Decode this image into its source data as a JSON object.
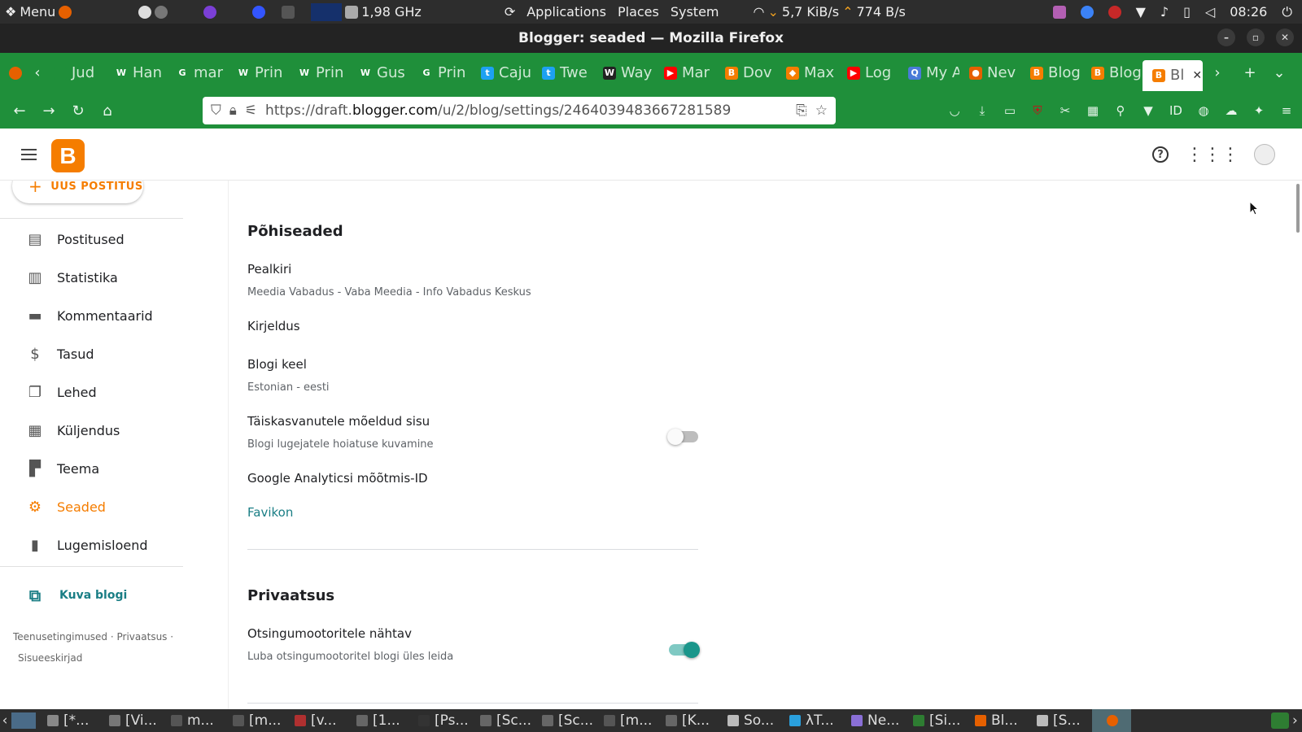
{
  "system_panel": {
    "menu_label": "Menu",
    "cpu_freq": "1,98 GHz",
    "menus": [
      "Applications",
      "Places",
      "System"
    ],
    "net_down": "5,7 KiB/s",
    "net_up": "774 B/s",
    "clock": "08:26"
  },
  "window": {
    "title": "Blogger: seaded — Mozilla Firefox"
  },
  "tabs": [
    {
      "label": "Jud",
      "fav": "",
      "color": "#1f8f3a"
    },
    {
      "label": "Han",
      "fav": "W",
      "color": "#ffffff"
    },
    {
      "label": "mar",
      "fav": "G",
      "color": "#ffffff"
    },
    {
      "label": "Prin",
      "fav": "W",
      "color": "#ffffff"
    },
    {
      "label": "Prin",
      "fav": "W",
      "color": "#ffffff"
    },
    {
      "label": "Gus",
      "fav": "W",
      "color": "#ffffff"
    },
    {
      "label": "Prin",
      "fav": "G",
      "color": "#ffffff"
    },
    {
      "label": "Caju",
      "fav": "t",
      "color": "#1da1f2"
    },
    {
      "label": "Twe",
      "fav": "t",
      "color": "#1da1f2"
    },
    {
      "label": "Way",
      "fav": "W",
      "color": "#222222"
    },
    {
      "label": "Mar",
      "fav": "▶",
      "color": "#ff0000"
    },
    {
      "label": "Dov",
      "fav": "B",
      "color": "#f57d00"
    },
    {
      "label": "Max",
      "fav": "◆",
      "color": "#f57d00"
    },
    {
      "label": "Log",
      "fav": "▶",
      "color": "#ff0000"
    },
    {
      "label": "My A",
      "fav": "Q",
      "color": "#4a7bd8"
    },
    {
      "label": "Nev",
      "fav": "●",
      "color": "#e66000"
    },
    {
      "label": "Blog",
      "fav": "B",
      "color": "#f57d00"
    },
    {
      "label": "Blog",
      "fav": "B",
      "color": "#f57d00"
    }
  ],
  "active_tab": {
    "label": "Bl",
    "fav": "B"
  },
  "url": {
    "prefix": "https://draft.",
    "domain": "blogger.com",
    "path": "/u/2/blog/settings/2464039483667281589"
  },
  "sidebar": {
    "new_post": "UUS POSTITUS",
    "items": [
      {
        "label": "Postitused",
        "icon": "posts-icon",
        "glyph": "▤"
      },
      {
        "label": "Statistika",
        "icon": "stats-icon",
        "glyph": "▥"
      },
      {
        "label": "Kommentaarid",
        "icon": "comments-icon",
        "glyph": "▬"
      },
      {
        "label": "Tasud",
        "icon": "dollar-icon",
        "glyph": "$"
      },
      {
        "label": "Lehed",
        "icon": "pages-icon",
        "glyph": "❐"
      },
      {
        "label": "Küljendus",
        "icon": "layout-icon",
        "glyph": "▦"
      },
      {
        "label": "Teema",
        "icon": "theme-icon",
        "glyph": "▛"
      },
      {
        "label": "Seaded",
        "icon": "gear-icon",
        "glyph": "⚙"
      },
      {
        "label": "Lugemisloend",
        "icon": "bookmark-icon",
        "glyph": "▮"
      }
    ],
    "view_blog": "Kuva blogi",
    "footer": {
      "terms": "Teenusetingimused",
      "privacy": "Privaatsus",
      "content_policy": "Sisueeskirjad"
    }
  },
  "settings": {
    "basic_title": "Põhiseaded",
    "title_label": "Pealkiri",
    "title_value": "Meedia Vabadus - Vaba Meedia - Info Vabadus Keskus",
    "description_label": "Kirjeldus",
    "language_label": "Blogi keel",
    "language_value": "Estonian - eesti",
    "adult_label": "Täiskasvanutele mõeldud sisu",
    "adult_sub": "Blogi lugejatele hoiatuse kuvamine",
    "adult_enabled": false,
    "analytics_label": "Google Analyticsi mõõtmis-ID",
    "favicon_label": "Favikon",
    "privacy_title": "Privaatsus",
    "search_label": "Otsingumootoritele nähtav",
    "search_sub": "Luba otsingumootoritel blogi üles leida",
    "search_enabled": true
  },
  "taskbar": [
    {
      "label": "[*..."
    },
    {
      "label": "[Vi..."
    },
    {
      "label": "m..."
    },
    {
      "label": "[m..."
    },
    {
      "label": "[v..."
    },
    {
      "label": "[1..."
    },
    {
      "label": "[Ps..."
    },
    {
      "label": "[Sc..."
    },
    {
      "label": "[Sc..."
    },
    {
      "label": "[m..."
    },
    {
      "label": "[K..."
    },
    {
      "label": "So..."
    },
    {
      "label": "λT..."
    },
    {
      "label": "Ne..."
    },
    {
      "label": "[Si..."
    },
    {
      "label": "Bl..."
    },
    {
      "label": "[S..."
    }
  ],
  "colors": {
    "accent": "#f57d00",
    "teal": "#1a7e85",
    "browser_green": "#1f8f3a"
  }
}
